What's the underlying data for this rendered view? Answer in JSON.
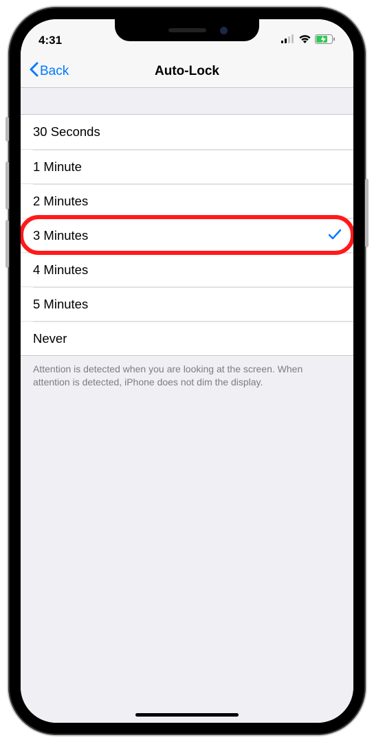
{
  "status": {
    "time": "4:31"
  },
  "nav": {
    "back_label": "Back",
    "title": "Auto-Lock"
  },
  "options": [
    {
      "label": "30 Seconds",
      "selected": false
    },
    {
      "label": "1 Minute",
      "selected": false
    },
    {
      "label": "2 Minutes",
      "selected": false
    },
    {
      "label": "3 Minutes",
      "selected": true,
      "highlighted": true
    },
    {
      "label": "4 Minutes",
      "selected": false
    },
    {
      "label": "5 Minutes",
      "selected": false
    },
    {
      "label": "Never",
      "selected": false
    }
  ],
  "footer_note": "Attention is detected when you are looking at the screen. When attention is detected, iPhone does not dim the display."
}
